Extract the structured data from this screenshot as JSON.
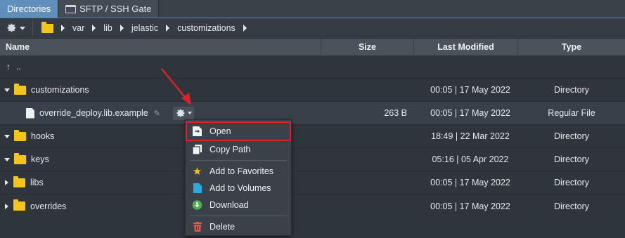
{
  "tabs": [
    {
      "label": "Directories",
      "active": true
    },
    {
      "label": "SFTP / SSH Gate",
      "active": false
    }
  ],
  "breadcrumb": [
    "var",
    "lib",
    "jelastic",
    "customizations"
  ],
  "columns": {
    "name": "Name",
    "size": "Size",
    "modified": "Last Modified",
    "type": "Type"
  },
  "parent_row": {
    "label": ".."
  },
  "rows": [
    {
      "name": "customizations",
      "size": "",
      "modified": "00:05 | 17 May 2022",
      "type": "Directory"
    },
    {
      "name": "override_deploy.lib.example",
      "size": "263 B",
      "modified": "00:05 | 17 May 2022",
      "type": "Regular File"
    },
    {
      "name": "hooks",
      "size": "",
      "modified": "18:49 | 22 Mar 2022",
      "type": "Directory"
    },
    {
      "name": "keys",
      "size": "",
      "modified": "05:16 | 05 Apr 2022",
      "type": "Directory"
    },
    {
      "name": "libs",
      "size": "",
      "modified": "00:05 | 17 May 2022",
      "type": "Directory"
    },
    {
      "name": "overrides",
      "size": "",
      "modified": "00:05 | 17 May 2022",
      "type": "Directory"
    }
  ],
  "context_menu": {
    "open": "Open",
    "copy_path": "Copy Path",
    "add_favorites": "Add to Favorites",
    "add_volumes": "Add to Volumes",
    "download": "Download",
    "delete": "Delete"
  },
  "colors": {
    "accent_tab": "#5f8fba",
    "folder": "#f5c518",
    "highlight": "#d8232a",
    "download": "#4caf50",
    "delete": "#e05a4f",
    "volumes": "#2fa8e0"
  }
}
